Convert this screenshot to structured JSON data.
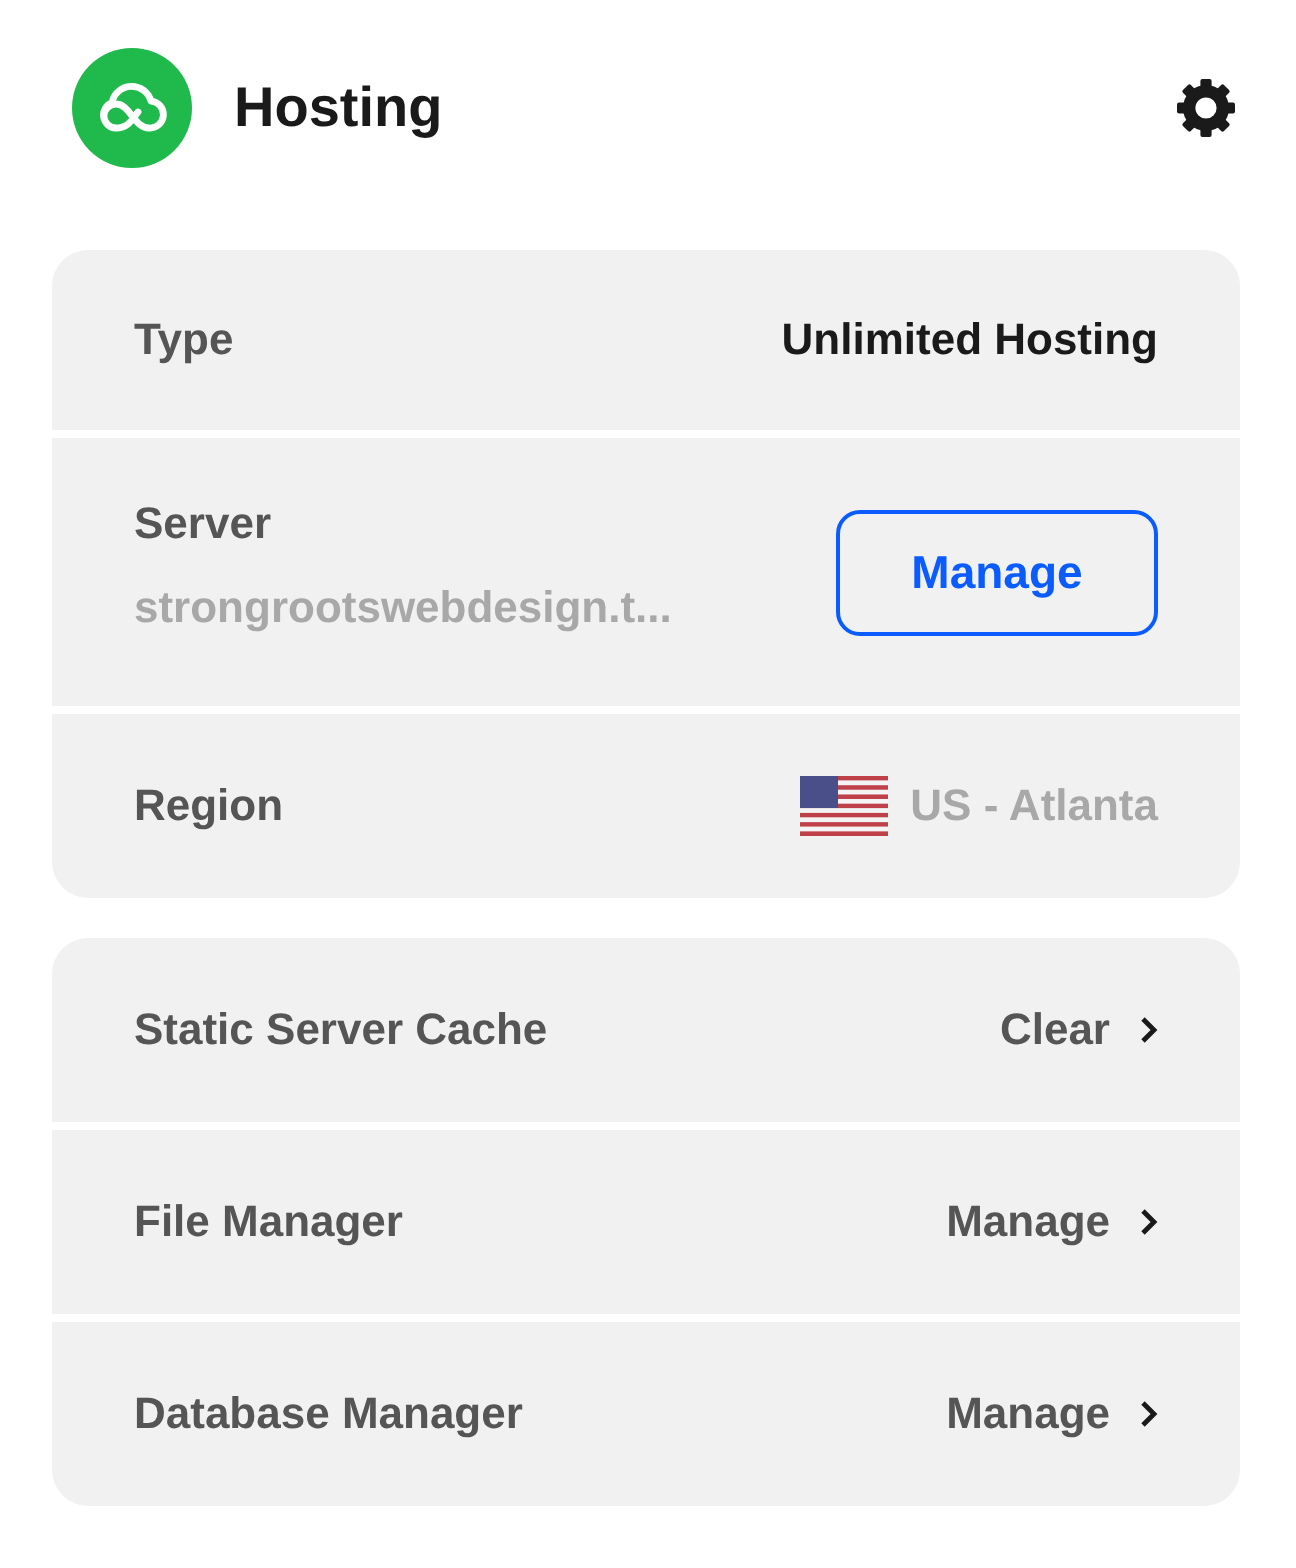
{
  "header": {
    "title": "Hosting"
  },
  "details": [
    {
      "kind": "text",
      "label": "Type",
      "value": "Unlimited Hosting"
    },
    {
      "kind": "server",
      "label": "Server",
      "value": "strongrootswebdesign.t...",
      "button": "Manage"
    },
    {
      "kind": "region",
      "label": "Region",
      "value": "US - Atlanta"
    }
  ],
  "tools": [
    {
      "label": "Static Server Cache",
      "action": "Clear"
    },
    {
      "label": "File Manager",
      "action": "Manage"
    },
    {
      "label": "Database Manager",
      "action": "Manage"
    }
  ]
}
